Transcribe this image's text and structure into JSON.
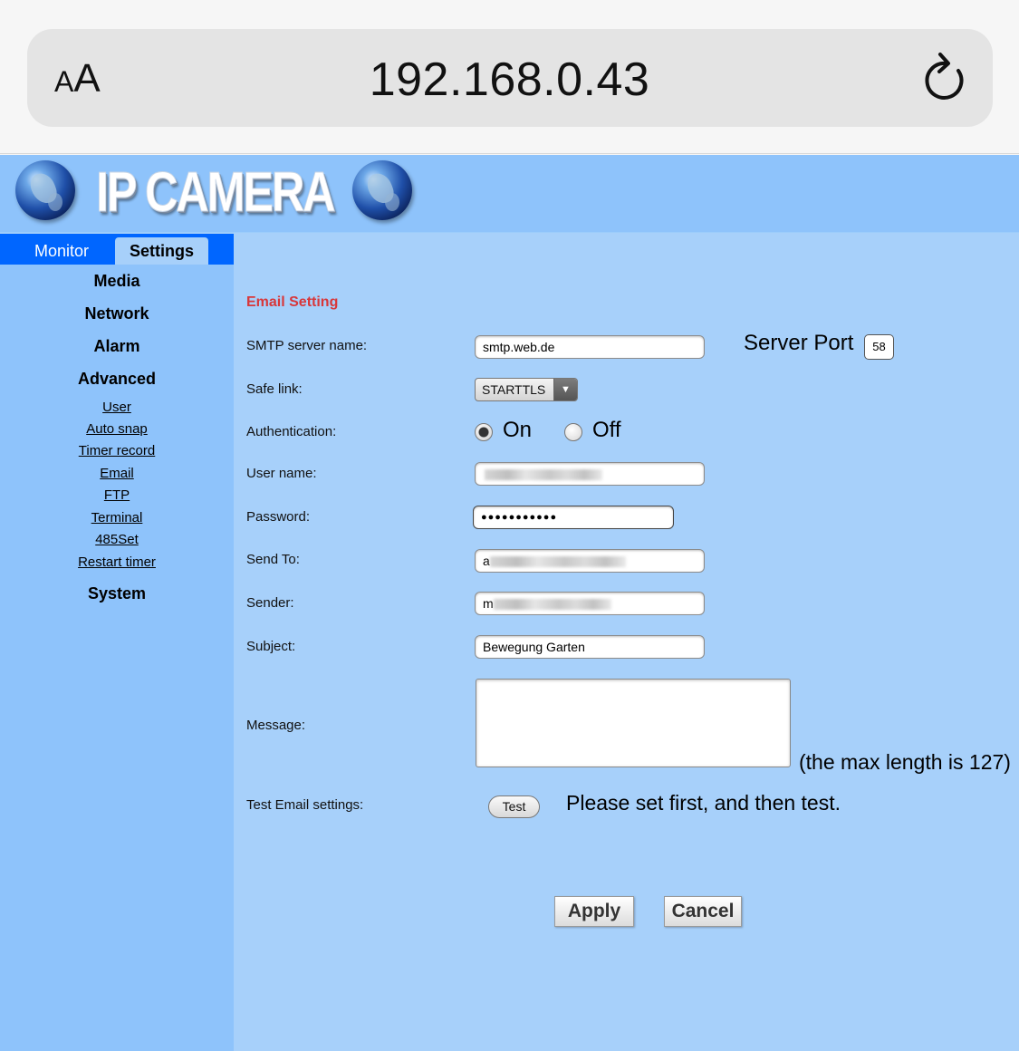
{
  "browser": {
    "text_size_label": "AA",
    "url": "192.168.0.43",
    "reload_icon": "reload-icon"
  },
  "banner": {
    "logo_text": "IP CAMERA"
  },
  "tabs": {
    "monitor": "Monitor",
    "settings": "Settings"
  },
  "menu": {
    "media": "Media",
    "network": "Network",
    "alarm": "Alarm",
    "advanced": "Advanced",
    "links": [
      "User",
      "Auto snap",
      "Timer record",
      "Email",
      "FTP",
      "Terminal",
      "485Set",
      "Restart timer"
    ],
    "system": "System"
  },
  "form": {
    "title": "Email Setting",
    "smtp_label": "SMTP server name:",
    "smtp_value": "smtp.web.de",
    "server_port_label": "Server Port",
    "server_port_value": "58",
    "safe_link_label": "Safe link:",
    "safe_link_value": "STARTTLS",
    "auth_label": "Authentication:",
    "auth_on": "On",
    "auth_off": "Off",
    "username_label": "User name:",
    "password_label": "Password:",
    "password_mask": "●●●●●●●●●●●",
    "sendto_label": "Send To:",
    "sendto_prefix": "a",
    "sender_label": "Sender:",
    "sender_prefix": "m",
    "subject_label": "Subject:",
    "subject_value": "Bewegung Garten",
    "message_label": "Message:",
    "message_hint": "(the max length is 127)",
    "test_label": "Test Email settings:",
    "test_button": "Test",
    "test_message": "Please set first, and then test.",
    "apply": "Apply",
    "cancel": "Cancel"
  }
}
